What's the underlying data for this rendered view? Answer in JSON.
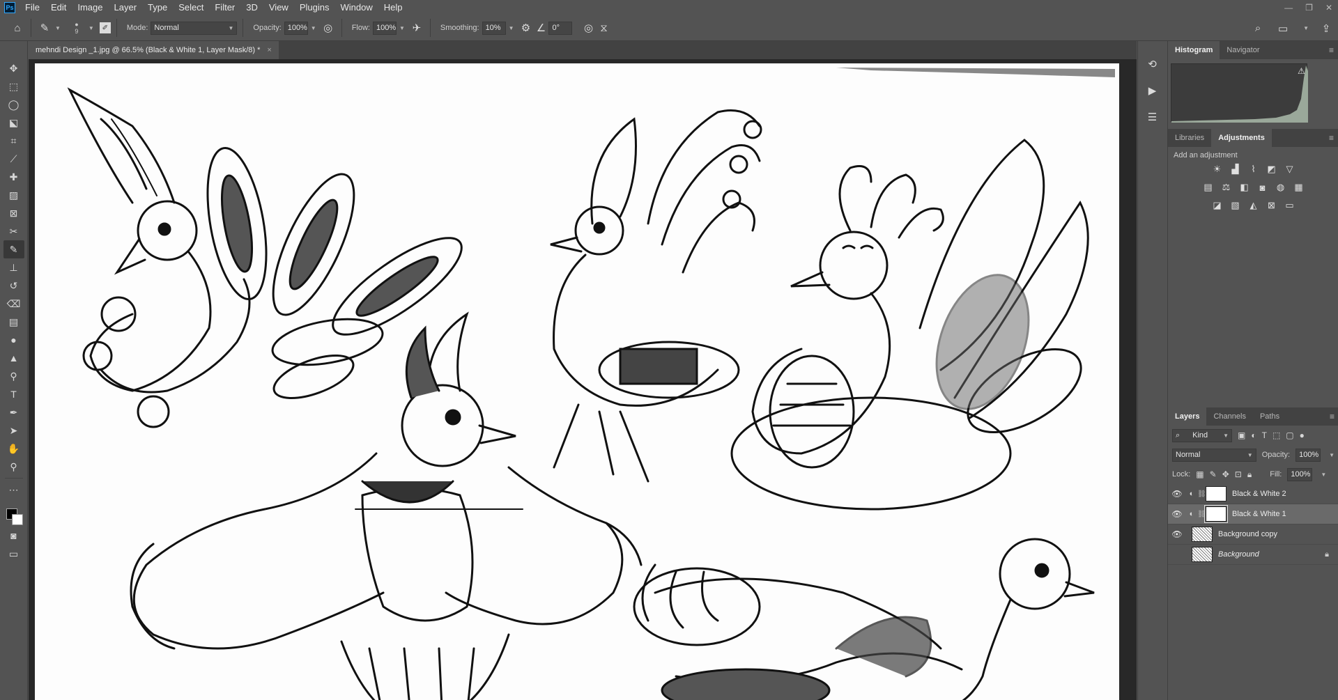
{
  "app": {
    "logo": "Ps"
  },
  "menu": [
    "File",
    "Edit",
    "Image",
    "Layer",
    "Type",
    "Select",
    "Filter",
    "3D",
    "View",
    "Plugins",
    "Window",
    "Help"
  ],
  "options_bar": {
    "brush_size": "9",
    "mode_label": "Mode:",
    "mode_value": "Normal",
    "opacity_label": "Opacity:",
    "opacity_value": "100%",
    "flow_label": "Flow:",
    "flow_value": "100%",
    "smoothing_label": "Smoothing:",
    "smoothing_value": "10%",
    "angle_value": "0°"
  },
  "document": {
    "tab_title": "mehndi Design _1.jpg @ 66.5% (Black & White 1, Layer Mask/8) *",
    "close_glyph": "×"
  },
  "panels": {
    "histogram_tabs": [
      "Histogram",
      "Navigator"
    ],
    "adjust_tabs": [
      "Libraries",
      "Adjustments"
    ],
    "add_adjustment": "Add an adjustment",
    "layers_tabs": [
      "Layers",
      "Channels",
      "Paths"
    ],
    "filter_kind": "Kind",
    "blend_mode": "Normal",
    "opacity_label": "Opacity:",
    "opacity_value": "100%",
    "lock_label": "Lock:",
    "fill_label": "Fill:",
    "fill_value": "100%"
  },
  "layers": [
    {
      "name": "Black & White 2",
      "visible": true,
      "selected": false,
      "type": "adjustment"
    },
    {
      "name": "Black & White 1",
      "visible": true,
      "selected": true,
      "type": "adjustment"
    },
    {
      "name": "Background copy",
      "visible": true,
      "selected": false,
      "type": "image"
    },
    {
      "name": "Background",
      "visible": false,
      "selected": false,
      "type": "image",
      "locked": true
    }
  ],
  "colors": {
    "ui_bg": "#535353",
    "ui_dark": "#424242",
    "canvas_bg": "#282828",
    "selected_layer": "#6a6a6a",
    "accent": "#31a8ff"
  }
}
